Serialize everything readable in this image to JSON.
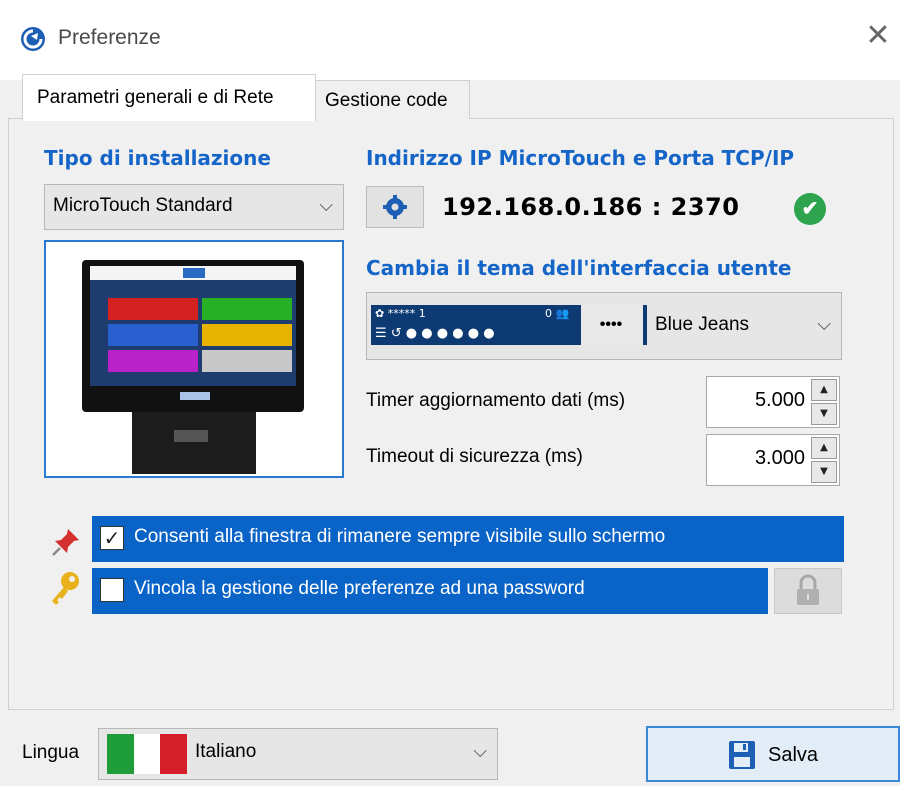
{
  "window": {
    "title": "Preferenze",
    "close_glyph": "✕",
    "app_icon": "app-logo-icon"
  },
  "tabs": [
    {
      "label": "Parametri generali e di Rete",
      "active": true
    },
    {
      "label": "Gestione code",
      "active": false
    }
  ],
  "installation": {
    "header": "Tipo di installazione",
    "selected": "MicroTouch Standard",
    "chevron": "⌵"
  },
  "network": {
    "header": "Indirizzo IP MicroTouch e Porta TCP/IP",
    "address": "192.168.0.186 : 2370",
    "status_glyph": "✔"
  },
  "theme": {
    "header": "Cambia il tema dell'interfaccia utente",
    "preview_line1": "✿ ***** 1",
    "preview_badge": "0 👥",
    "preview_line2": "☰ ↺ ● ● ● ● ● ●",
    "preview_dots": "••••",
    "selected": "Blue Jeans",
    "chevron": "⌵",
    "accent_color": "#0d3a73"
  },
  "timers": {
    "refresh_label": "Timer aggiornamento dati (ms)",
    "refresh_value": "5.000",
    "timeout_label": "Timeout di sicurezza (ms)",
    "timeout_value": "3.000",
    "up_glyph": "▲",
    "down_glyph": "▼"
  },
  "options": {
    "always_on_top_label": "Consenti alla finestra di rimanere sempre visibile sullo schermo",
    "always_on_top_checked": true,
    "password_label": "Vincola la gestione delle preferenze ad una password",
    "password_checked": false,
    "check_glyph": "✓",
    "bar_color": "#0a64c8"
  },
  "footer": {
    "language_label": "Lingua",
    "language_selected": "Italiano",
    "chevron": "⌵",
    "save_label": "Salva"
  }
}
